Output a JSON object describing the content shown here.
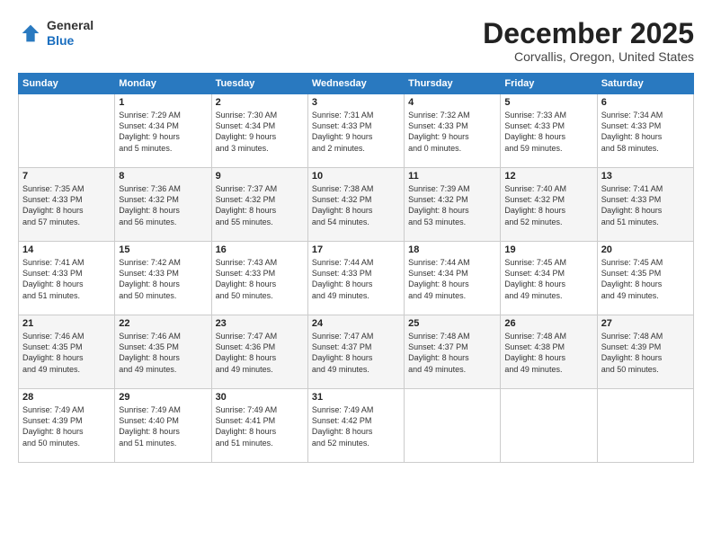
{
  "header": {
    "logo": {
      "line1": "General",
      "line2": "Blue"
    },
    "title": "December 2025",
    "location": "Corvallis, Oregon, United States"
  },
  "calendar": {
    "days_of_week": [
      "Sunday",
      "Monday",
      "Tuesday",
      "Wednesday",
      "Thursday",
      "Friday",
      "Saturday"
    ],
    "weeks": [
      [
        {
          "day": "",
          "info": ""
        },
        {
          "day": "1",
          "info": "Sunrise: 7:29 AM\nSunset: 4:34 PM\nDaylight: 9 hours\nand 5 minutes."
        },
        {
          "day": "2",
          "info": "Sunrise: 7:30 AM\nSunset: 4:34 PM\nDaylight: 9 hours\nand 3 minutes."
        },
        {
          "day": "3",
          "info": "Sunrise: 7:31 AM\nSunset: 4:33 PM\nDaylight: 9 hours\nand 2 minutes."
        },
        {
          "day": "4",
          "info": "Sunrise: 7:32 AM\nSunset: 4:33 PM\nDaylight: 9 hours\nand 0 minutes."
        },
        {
          "day": "5",
          "info": "Sunrise: 7:33 AM\nSunset: 4:33 PM\nDaylight: 8 hours\nand 59 minutes."
        },
        {
          "day": "6",
          "info": "Sunrise: 7:34 AM\nSunset: 4:33 PM\nDaylight: 8 hours\nand 58 minutes."
        }
      ],
      [
        {
          "day": "7",
          "info": "Sunrise: 7:35 AM\nSunset: 4:33 PM\nDaylight: 8 hours\nand 57 minutes."
        },
        {
          "day": "8",
          "info": "Sunrise: 7:36 AM\nSunset: 4:32 PM\nDaylight: 8 hours\nand 56 minutes."
        },
        {
          "day": "9",
          "info": "Sunrise: 7:37 AM\nSunset: 4:32 PM\nDaylight: 8 hours\nand 55 minutes."
        },
        {
          "day": "10",
          "info": "Sunrise: 7:38 AM\nSunset: 4:32 PM\nDaylight: 8 hours\nand 54 minutes."
        },
        {
          "day": "11",
          "info": "Sunrise: 7:39 AM\nSunset: 4:32 PM\nDaylight: 8 hours\nand 53 minutes."
        },
        {
          "day": "12",
          "info": "Sunrise: 7:40 AM\nSunset: 4:32 PM\nDaylight: 8 hours\nand 52 minutes."
        },
        {
          "day": "13",
          "info": "Sunrise: 7:41 AM\nSunset: 4:33 PM\nDaylight: 8 hours\nand 51 minutes."
        }
      ],
      [
        {
          "day": "14",
          "info": "Sunrise: 7:41 AM\nSunset: 4:33 PM\nDaylight: 8 hours\nand 51 minutes."
        },
        {
          "day": "15",
          "info": "Sunrise: 7:42 AM\nSunset: 4:33 PM\nDaylight: 8 hours\nand 50 minutes."
        },
        {
          "day": "16",
          "info": "Sunrise: 7:43 AM\nSunset: 4:33 PM\nDaylight: 8 hours\nand 50 minutes."
        },
        {
          "day": "17",
          "info": "Sunrise: 7:44 AM\nSunset: 4:33 PM\nDaylight: 8 hours\nand 49 minutes."
        },
        {
          "day": "18",
          "info": "Sunrise: 7:44 AM\nSunset: 4:34 PM\nDaylight: 8 hours\nand 49 minutes."
        },
        {
          "day": "19",
          "info": "Sunrise: 7:45 AM\nSunset: 4:34 PM\nDaylight: 8 hours\nand 49 minutes."
        },
        {
          "day": "20",
          "info": "Sunrise: 7:45 AM\nSunset: 4:35 PM\nDaylight: 8 hours\nand 49 minutes."
        }
      ],
      [
        {
          "day": "21",
          "info": "Sunrise: 7:46 AM\nSunset: 4:35 PM\nDaylight: 8 hours\nand 49 minutes."
        },
        {
          "day": "22",
          "info": "Sunrise: 7:46 AM\nSunset: 4:35 PM\nDaylight: 8 hours\nand 49 minutes."
        },
        {
          "day": "23",
          "info": "Sunrise: 7:47 AM\nSunset: 4:36 PM\nDaylight: 8 hours\nand 49 minutes."
        },
        {
          "day": "24",
          "info": "Sunrise: 7:47 AM\nSunset: 4:37 PM\nDaylight: 8 hours\nand 49 minutes."
        },
        {
          "day": "25",
          "info": "Sunrise: 7:48 AM\nSunset: 4:37 PM\nDaylight: 8 hours\nand 49 minutes."
        },
        {
          "day": "26",
          "info": "Sunrise: 7:48 AM\nSunset: 4:38 PM\nDaylight: 8 hours\nand 49 minutes."
        },
        {
          "day": "27",
          "info": "Sunrise: 7:48 AM\nSunset: 4:39 PM\nDaylight: 8 hours\nand 50 minutes."
        }
      ],
      [
        {
          "day": "28",
          "info": "Sunrise: 7:49 AM\nSunset: 4:39 PM\nDaylight: 8 hours\nand 50 minutes."
        },
        {
          "day": "29",
          "info": "Sunrise: 7:49 AM\nSunset: 4:40 PM\nDaylight: 8 hours\nand 51 minutes."
        },
        {
          "day": "30",
          "info": "Sunrise: 7:49 AM\nSunset: 4:41 PM\nDaylight: 8 hours\nand 51 minutes."
        },
        {
          "day": "31",
          "info": "Sunrise: 7:49 AM\nSunset: 4:42 PM\nDaylight: 8 hours\nand 52 minutes."
        },
        {
          "day": "",
          "info": ""
        },
        {
          "day": "",
          "info": ""
        },
        {
          "day": "",
          "info": ""
        }
      ]
    ]
  }
}
